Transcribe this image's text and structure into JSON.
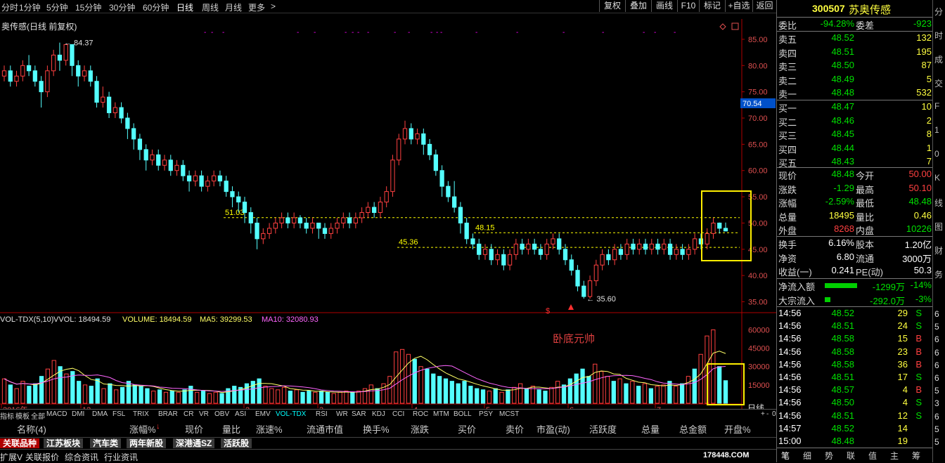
{
  "colors": {
    "up": "#ff4040",
    "down": "#54ffff",
    "ma5": "#ffff66",
    "ma10": "#ff66ff",
    "dashed": "#ffff00",
    "highlight": "#ffee00"
  },
  "periods": [
    "分时",
    "1分钟",
    "5分钟",
    "15分钟",
    "30分钟",
    "60分钟",
    "日线",
    "周线",
    "月线",
    "更多"
  ],
  "period_arrow": ">",
  "toolbar": [
    "复权",
    "叠加",
    "画线",
    "F10",
    "标记",
    "+自选",
    "返回"
  ],
  "chart_title": "奥传感(日线 前复权)",
  "stock_code": "300507",
  "stock_name": "苏奥传感",
  "price_labels": {
    "high": "84.37",
    "low": "35.60",
    "line1": "51.03",
    "line2": "48.15",
    "line3": "45.36",
    "current": "70.54"
  },
  "y_axis": [
    "85.00",
    "80.00",
    "75.00",
    "70.00",
    "65.00",
    "60.00",
    "55.00",
    "50.00",
    "45.00",
    "40.00",
    "35.00"
  ],
  "vol_axis": [
    "60000",
    "45000",
    "30000",
    "15000"
  ],
  "vol_header": {
    "name": "VOL-TDX(5,10)",
    "vvol": "VVOL: 18494.59",
    "volume": "VOLUME: 18494.59",
    "ma5": "MA5: 39299.53",
    "ma10": "MA10: 32080.93"
  },
  "annotation": "卧底元帅",
  "date_labels": [
    "2016年",
    "12",
    "2",
    "3",
    "4",
    "5",
    "6",
    "7"
  ],
  "date_mode": "日线",
  "ind_tabs": [
    "指标",
    "模板",
    "全部",
    "MACD",
    "DMI",
    "DMA",
    "FSL",
    "TRIX",
    "BRAR",
    "CR",
    "VR",
    "OBV",
    "ASI",
    "EMV",
    "VOL-TDX",
    "RSI",
    "WR",
    "SAR",
    "KDJ",
    "CCI",
    "ROC",
    "MTM",
    "BOLL",
    "PSY",
    "MCST"
  ],
  "ind_controls": [
    "+",
    "-",
    "0"
  ],
  "table_header": [
    "名称(4)",
    "涨幅%",
    "现价",
    "量比",
    "涨速%",
    "流通市值",
    "换手%",
    "涨跌",
    "买价",
    "卖价",
    "市盈(动)",
    "活跃度",
    "总量",
    "总金额",
    "开盘%"
  ],
  "bottom_tabs": [
    "关联品种",
    "江苏板块",
    "汽车类",
    "两年新股",
    "深港通SZ",
    "活跃股"
  ],
  "sub_tabs": [
    "扩展V",
    "关联报价",
    "综合资讯",
    "行业资讯"
  ],
  "panel": {
    "wei": {
      "l1": "委比",
      "v1": "-94.28%",
      "l2": "委差",
      "v2": "-923"
    },
    "sell": [
      {
        "l": "卖五",
        "p": "48.52",
        "v": "132"
      },
      {
        "l": "卖四",
        "p": "48.51",
        "v": "195"
      },
      {
        "l": "卖三",
        "p": "48.50",
        "v": "87"
      },
      {
        "l": "卖二",
        "p": "48.49",
        "v": "5"
      },
      {
        "l": "卖一",
        "p": "48.48",
        "v": "532"
      }
    ],
    "buy": [
      {
        "l": "买一",
        "p": "48.47",
        "v": "10"
      },
      {
        "l": "买二",
        "p": "48.46",
        "v": "2"
      },
      {
        "l": "买三",
        "p": "48.45",
        "v": "8"
      },
      {
        "l": "买四",
        "p": "48.44",
        "v": "1"
      },
      {
        "l": "买五",
        "p": "48.43",
        "v": "7"
      }
    ],
    "quote": [
      {
        "l1": "现价",
        "v1": "48.48",
        "l2": "今开",
        "v2": "50.00"
      },
      {
        "l1": "涨跌",
        "v1": "-1.29",
        "l2": "最高",
        "v2": "50.10"
      },
      {
        "l1": "涨幅",
        "v1": "-2.59%",
        "l2": "最低",
        "v2": "48.48"
      },
      {
        "l1": "总量",
        "v1": "18495",
        "l2": "量比",
        "v2": "0.46"
      },
      {
        "l1": "外盘",
        "v1": "8268",
        "l2": "内盘",
        "v2": "10226"
      }
    ],
    "stats": [
      {
        "l1": "换手",
        "v1": "6.16%",
        "l2": "股本",
        "v2": "1.20亿"
      },
      {
        "l1": "净资",
        "v1": "6.80",
        "l2": "流通",
        "v2": "3000万"
      },
      {
        "l1": "收益(一)",
        "v1": "0.241",
        "l2": "PE(动)",
        "v2": "50.3"
      }
    ],
    "flow": [
      {
        "l": "净流入额",
        "v": "-1299万",
        "p": "-14%"
      },
      {
        "l": "大宗流入",
        "v": "-292.0万",
        "p": "-3%"
      }
    ],
    "ticks": [
      {
        "t": "14:56",
        "p": "48.52",
        "v": "29",
        "s": "S"
      },
      {
        "t": "14:56",
        "p": "48.51",
        "v": "24",
        "s": "S"
      },
      {
        "t": "14:56",
        "p": "48.58",
        "v": "15",
        "s": "B"
      },
      {
        "t": "14:56",
        "p": "48.58",
        "v": "23",
        "s": "B"
      },
      {
        "t": "14:56",
        "p": "48.58",
        "v": "36",
        "s": "B"
      },
      {
        "t": "14:56",
        "p": "48.51",
        "v": "17",
        "s": "S"
      },
      {
        "t": "14:56",
        "p": "48.57",
        "v": "4",
        "s": "B"
      },
      {
        "t": "14:56",
        "p": "48.50",
        "v": "4",
        "s": "S"
      },
      {
        "t": "14:56",
        "p": "48.51",
        "v": "12",
        "s": "S"
      },
      {
        "t": "14:57",
        "p": "48.52",
        "v": "14",
        "s": ""
      },
      {
        "t": "15:00",
        "p": "48.48",
        "v": "19",
        "s": ""
      }
    ],
    "side_digits": [
      "6",
      "5",
      "6",
      "6",
      "6",
      "6",
      "5",
      "3",
      "6",
      "5",
      "5"
    ],
    "footer_tabs": [
      "笔",
      "细",
      "势",
      "联",
      "值",
      "主",
      "筹"
    ]
  },
  "vbar": [
    "分",
    "时",
    "成",
    "交",
    "F",
    "1",
    "0",
    "K",
    "线",
    "图",
    "财",
    "务"
  ],
  "watermark": "178448.COM",
  "chart_data": {
    "type": "candlestick",
    "title": "奥传感(日线 前复权)",
    "ylim": [
      34,
      87
    ],
    "price_levels": [
      51.03,
      48.15,
      45.36
    ],
    "high": 84.37,
    "low": 35.6,
    "candles": [
      [
        78,
        79,
        77,
        80
      ],
      [
        79,
        77,
        76,
        80
      ],
      [
        77,
        78,
        76,
        79
      ],
      [
        78,
        80,
        77,
        81
      ],
      [
        80,
        79,
        78,
        82
      ],
      [
        79,
        77,
        76,
        80
      ],
      [
        77,
        75,
        72,
        78
      ],
      [
        75,
        79,
        74,
        80
      ],
      [
        79,
        82,
        78,
        83
      ],
      [
        82,
        81,
        79,
        84.37
      ],
      [
        81,
        84,
        80,
        84
      ],
      [
        84,
        80,
        78,
        84
      ],
      [
        80,
        78,
        76,
        81
      ],
      [
        78,
        79,
        77,
        80
      ],
      [
        79,
        77,
        76,
        80
      ],
      [
        77,
        73,
        72,
        78
      ],
      [
        73,
        74,
        72,
        76
      ],
      [
        74,
        71,
        70,
        75
      ],
      [
        71,
        72,
        70,
        73
      ],
      [
        72,
        70,
        69,
        73
      ],
      [
        70,
        68,
        66,
        71
      ],
      [
        68,
        66,
        64,
        69
      ],
      [
        66,
        64,
        62,
        67
      ],
      [
        64,
        62,
        60,
        65
      ],
      [
        62,
        63,
        61,
        64
      ],
      [
        63,
        61,
        60,
        64
      ],
      [
        61,
        62,
        60,
        63
      ],
      [
        62,
        60,
        59,
        63
      ],
      [
        60,
        61,
        59,
        62
      ],
      [
        61,
        59,
        58,
        62
      ],
      [
        59,
        58,
        56,
        60
      ],
      [
        58,
        59,
        57,
        60
      ],
      [
        59,
        57,
        56,
        60
      ],
      [
        57,
        58,
        56,
        59
      ],
      [
        58,
        59,
        57,
        60
      ],
      [
        59,
        58,
        57,
        60
      ],
      [
        58,
        56,
        55,
        59
      ],
      [
        56,
        55,
        53,
        57
      ],
      [
        55,
        54,
        52,
        56
      ],
      [
        54,
        52,
        50,
        55
      ],
      [
        52,
        50,
        48,
        53
      ],
      [
        50,
        47,
        45,
        51
      ],
      [
        47,
        48,
        46,
        49
      ],
      [
        48,
        49,
        47,
        50
      ],
      [
        49,
        50,
        48,
        51
      ],
      [
        50,
        51,
        49,
        52
      ],
      [
        51,
        50,
        49,
        52
      ],
      [
        50,
        51,
        49,
        52
      ],
      [
        51,
        50,
        49,
        51.5
      ],
      [
        50,
        49,
        48,
        51
      ],
      [
        49,
        50,
        48,
        51
      ],
      [
        50,
        49,
        47,
        50
      ],
      [
        49,
        48,
        47,
        50
      ],
      [
        48,
        49,
        47,
        50
      ],
      [
        49,
        50,
        48,
        51
      ],
      [
        50,
        51,
        49,
        52
      ],
      [
        51,
        50,
        49,
        52
      ],
      [
        50,
        51,
        49,
        52
      ],
      [
        51,
        52,
        50,
        53
      ],
      [
        52,
        53,
        51,
        54
      ],
      [
        53,
        52,
        51,
        54
      ],
      [
        52,
        54,
        51,
        55
      ],
      [
        54,
        56,
        53,
        57
      ],
      [
        56,
        62,
        55,
        63
      ],
      [
        62,
        66,
        61,
        67
      ],
      [
        66,
        68,
        65,
        69.5
      ],
      [
        68,
        66,
        65,
        69
      ],
      [
        66,
        67,
        65,
        68
      ],
      [
        67,
        65,
        63,
        68
      ],
      [
        65,
        63,
        62,
        66
      ],
      [
        63,
        60,
        59,
        64
      ],
      [
        60,
        57,
        55,
        61
      ],
      [
        57,
        55,
        54,
        58
      ],
      [
        55,
        53,
        52,
        58
      ],
      [
        53,
        50,
        48,
        54
      ],
      [
        50,
        47,
        46,
        51
      ],
      [
        47,
        46,
        45,
        48
      ],
      [
        46,
        44,
        43,
        47
      ],
      [
        44,
        45,
        43,
        46
      ],
      [
        45,
        43,
        42,
        46
      ],
      [
        43,
        44,
        42,
        45
      ],
      [
        44,
        42,
        41,
        45
      ],
      [
        42,
        44,
        41,
        45
      ],
      [
        44,
        46,
        43,
        47
      ],
      [
        46,
        45,
        44,
        47
      ],
      [
        45,
        46,
        44,
        47
      ],
      [
        46,
        45,
        44,
        47
      ],
      [
        45,
        44,
        43,
        46
      ],
      [
        44,
        46,
        43,
        47
      ],
      [
        46,
        47,
        45,
        48
      ],
      [
        47,
        45,
        44,
        48
      ],
      [
        45,
        43,
        42,
        46
      ],
      [
        43,
        41,
        40,
        44
      ],
      [
        41,
        38,
        37,
        42
      ],
      [
        38,
        36,
        35.6,
        39
      ],
      [
        36,
        39,
        35.6,
        40
      ],
      [
        39,
        42,
        38,
        43
      ],
      [
        42,
        44,
        41,
        45
      ],
      [
        44,
        43,
        42,
        45
      ],
      [
        43,
        45,
        42,
        46
      ],
      [
        45,
        44,
        43,
        46
      ],
      [
        44,
        46,
        43,
        47
      ],
      [
        46,
        45,
        44,
        47
      ],
      [
        45,
        46,
        44,
        47
      ],
      [
        46,
        45,
        44,
        47
      ],
      [
        45,
        46,
        44,
        47
      ],
      [
        46,
        45,
        44,
        47
      ],
      [
        45,
        46,
        44,
        47
      ],
      [
        46,
        44,
        43,
        47
      ],
      [
        44,
        45,
        43,
        46
      ],
      [
        45,
        44,
        43,
        46
      ],
      [
        44,
        45,
        43,
        46
      ],
      [
        45,
        47,
        44,
        48
      ],
      [
        47,
        46,
        45,
        48
      ],
      [
        46,
        48,
        45,
        49
      ],
      [
        48,
        50,
        47,
        51
      ],
      [
        50,
        49,
        48,
        50.1
      ],
      [
        49,
        48.48,
        48.48,
        50.1
      ]
    ],
    "volume": [
      [
        20000,
        1
      ],
      [
        15000,
        0
      ],
      [
        12000,
        1
      ],
      [
        18000,
        1
      ],
      [
        14000,
        0
      ],
      [
        16000,
        0
      ],
      [
        22000,
        0
      ],
      [
        28000,
        1
      ],
      [
        35000,
        1
      ],
      [
        30000,
        0
      ],
      [
        24000,
        1
      ],
      [
        26000,
        0
      ],
      [
        18000,
        0
      ],
      [
        15000,
        1
      ],
      [
        14000,
        0
      ],
      [
        20000,
        0
      ],
      [
        12000,
        1
      ],
      [
        16000,
        0
      ],
      [
        11000,
        1
      ],
      [
        13000,
        0
      ],
      [
        18000,
        0
      ],
      [
        15000,
        0
      ],
      [
        14000,
        0
      ],
      [
        12000,
        0
      ],
      [
        10000,
        1
      ],
      [
        11000,
        0
      ],
      [
        9000,
        1
      ],
      [
        10000,
        0
      ],
      [
        9000,
        1
      ],
      [
        11000,
        0
      ],
      [
        14000,
        0
      ],
      [
        9000,
        1
      ],
      [
        10000,
        0
      ],
      [
        8000,
        1
      ],
      [
        9000,
        1
      ],
      [
        8000,
        0
      ],
      [
        12000,
        0
      ],
      [
        14000,
        0
      ],
      [
        13000,
        0
      ],
      [
        16000,
        0
      ],
      [
        18000,
        0
      ],
      [
        20000,
        0
      ],
      [
        14000,
        1
      ],
      [
        12000,
        1
      ],
      [
        11000,
        1
      ],
      [
        13000,
        1
      ],
      [
        10000,
        0
      ],
      [
        11000,
        1
      ],
      [
        9000,
        0
      ],
      [
        10000,
        0
      ],
      [
        9000,
        1
      ],
      [
        10000,
        0
      ],
      [
        9000,
        0
      ],
      [
        8000,
        1
      ],
      [
        9000,
        1
      ],
      [
        10000,
        1
      ],
      [
        9000,
        0
      ],
      [
        10000,
        1
      ],
      [
        12000,
        1
      ],
      [
        15000,
        1
      ],
      [
        12000,
        0
      ],
      [
        16000,
        1
      ],
      [
        22000,
        1
      ],
      [
        42000,
        1
      ],
      [
        44000,
        1
      ],
      [
        40000,
        1
      ],
      [
        36000,
        0
      ],
      [
        30000,
        1
      ],
      [
        28000,
        0
      ],
      [
        24000,
        0
      ],
      [
        22000,
        0
      ],
      [
        20000,
        0
      ],
      [
        18000,
        0
      ],
      [
        16000,
        0
      ],
      [
        18000,
        0
      ],
      [
        14000,
        0
      ],
      [
        12000,
        0
      ],
      [
        11000,
        0
      ],
      [
        10000,
        1
      ],
      [
        12000,
        0
      ],
      [
        9000,
        1
      ],
      [
        11000,
        0
      ],
      [
        13000,
        1
      ],
      [
        16000,
        1
      ],
      [
        12000,
        0
      ],
      [
        14000,
        1
      ],
      [
        11000,
        0
      ],
      [
        10000,
        0
      ],
      [
        13000,
        1
      ],
      [
        18000,
        1
      ],
      [
        15000,
        0
      ],
      [
        20000,
        0
      ],
      [
        24000,
        0
      ],
      [
        28000,
        0
      ],
      [
        22000,
        0
      ],
      [
        32000,
        1
      ],
      [
        26000,
        1
      ],
      [
        22000,
        1
      ],
      [
        18000,
        0
      ],
      [
        20000,
        1
      ],
      [
        16000,
        0
      ],
      [
        18000,
        1
      ],
      [
        14000,
        0
      ],
      [
        16000,
        1
      ],
      [
        12000,
        0
      ],
      [
        14000,
        1
      ],
      [
        15000,
        1
      ],
      [
        18000,
        0
      ],
      [
        14000,
        1
      ],
      [
        16000,
        0
      ],
      [
        22000,
        1
      ],
      [
        28000,
        0
      ],
      [
        40000,
        1
      ],
      [
        55000,
        1
      ],
      [
        60000,
        1
      ],
      [
        30000,
        0
      ],
      [
        18494,
        0
      ]
    ]
  }
}
